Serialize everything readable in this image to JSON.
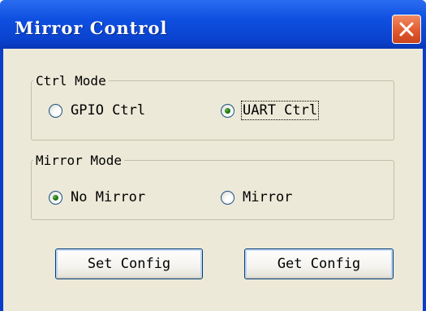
{
  "window": {
    "title": "Mirror Control"
  },
  "ctrl_mode": {
    "legend": "Ctrl Mode",
    "options": [
      {
        "label": "GPIO Ctrl",
        "selected": false
      },
      {
        "label": "UART Ctrl",
        "selected": true
      }
    ]
  },
  "mirror_mode": {
    "legend": "Mirror Mode",
    "options": [
      {
        "label": "No Mirror",
        "selected": true
      },
      {
        "label": "Mirror",
        "selected": false
      }
    ]
  },
  "buttons": {
    "set_config": "Set Config",
    "get_config": "Get Config"
  },
  "colors": {
    "titlebar": "#0a43cf",
    "client_bg": "#ece9d8",
    "close_button": "#e25a2e",
    "radio_dot": "#1c7d10"
  },
  "icons": {
    "close": "close-icon"
  }
}
